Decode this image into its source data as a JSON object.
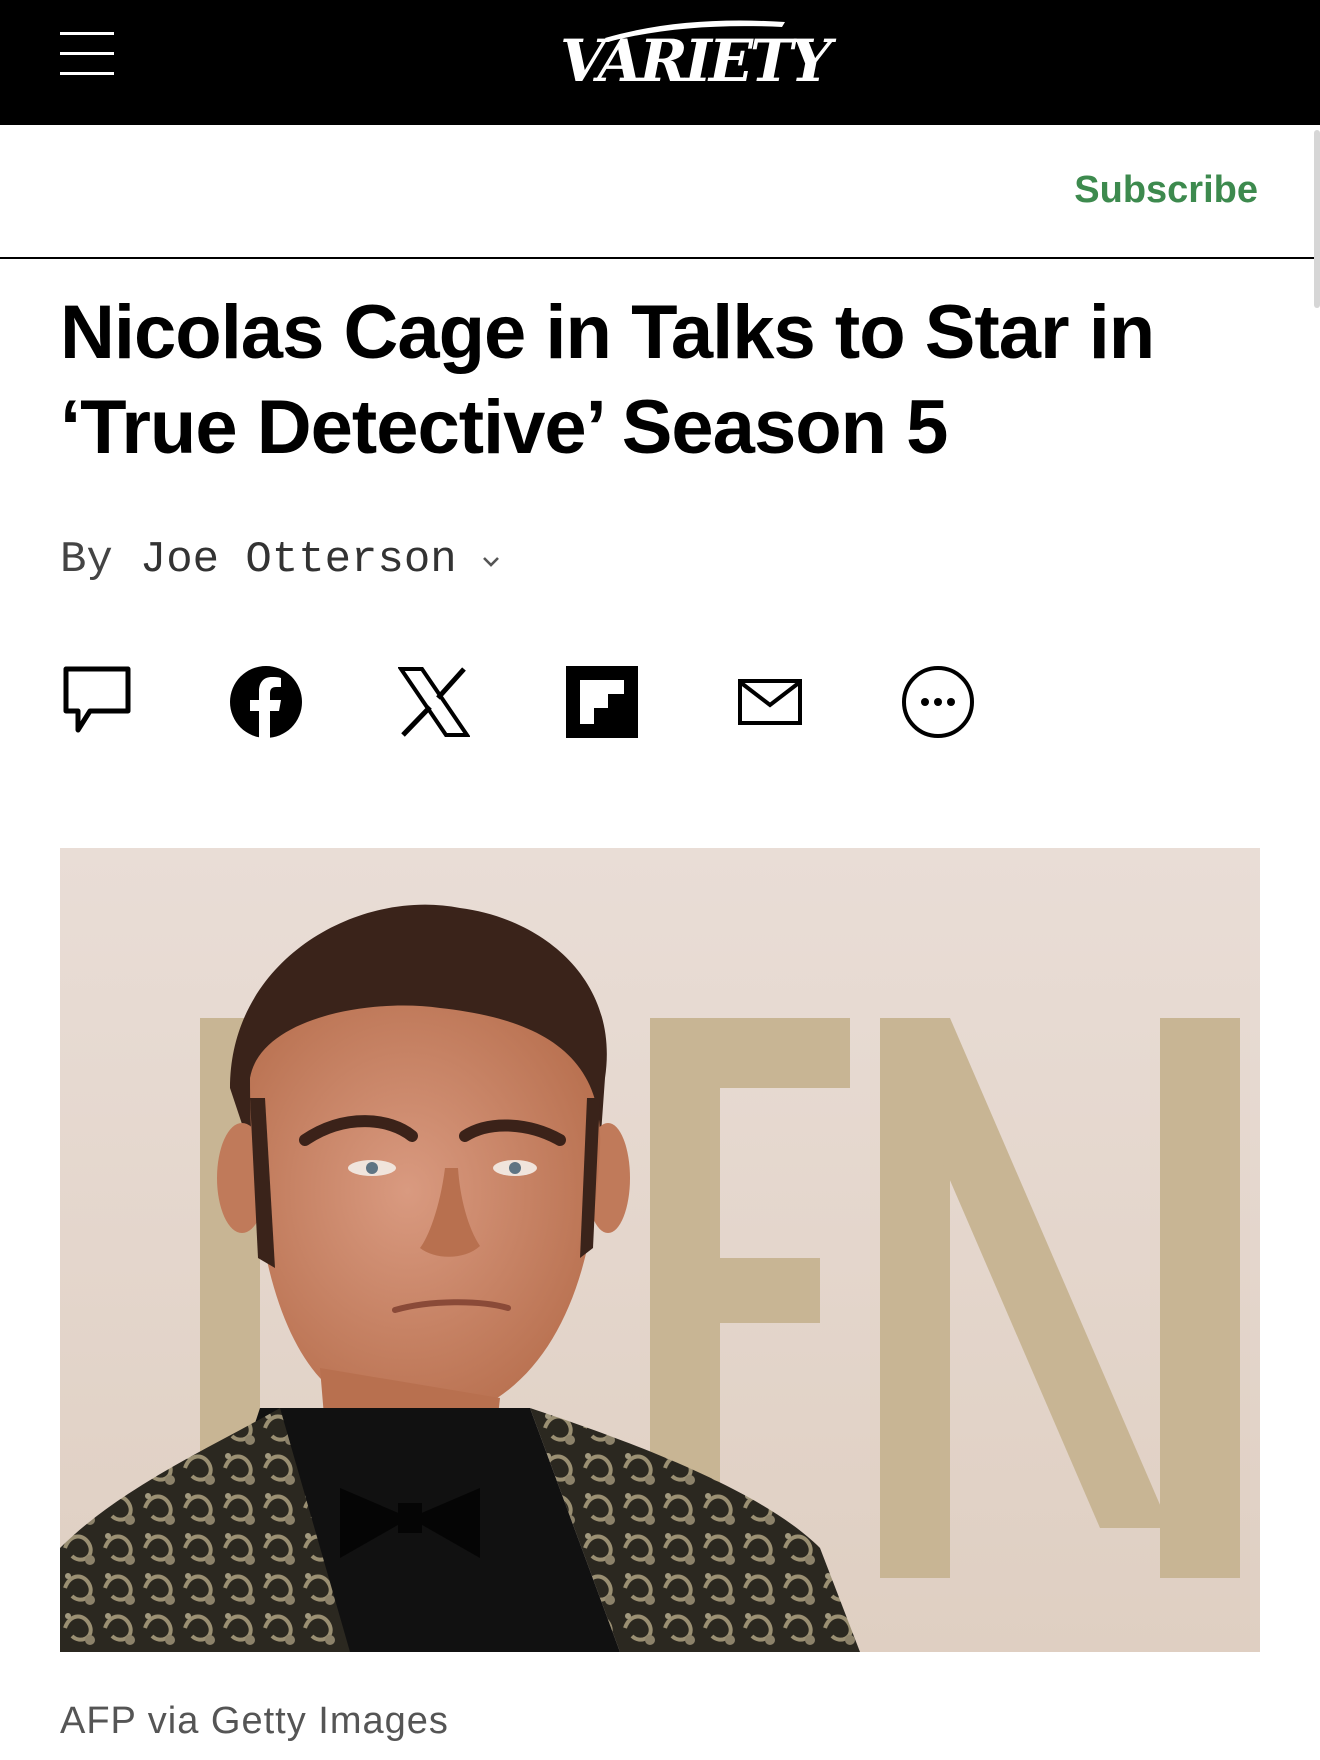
{
  "header": {
    "logo_text": "VARIETY",
    "menu_icon": "hamburger-menu-icon",
    "subscribe_label": "Subscribe"
  },
  "article": {
    "headline": "Nicolas Cage in Talks to Star in ‘True Detective’ Season 5",
    "byline_prefix": "By",
    "author": "Joe Otterson",
    "share_icons": [
      "comment-icon",
      "facebook-icon",
      "x-icon",
      "flipboard-icon",
      "email-icon",
      "more-icon"
    ],
    "photo_caption": "AFP via Getty Images"
  },
  "colors": {
    "topbar_background": "#000000",
    "subscribe_text": "#3d8a4e",
    "headline_text": "#000000",
    "byline_text": "#444444"
  }
}
